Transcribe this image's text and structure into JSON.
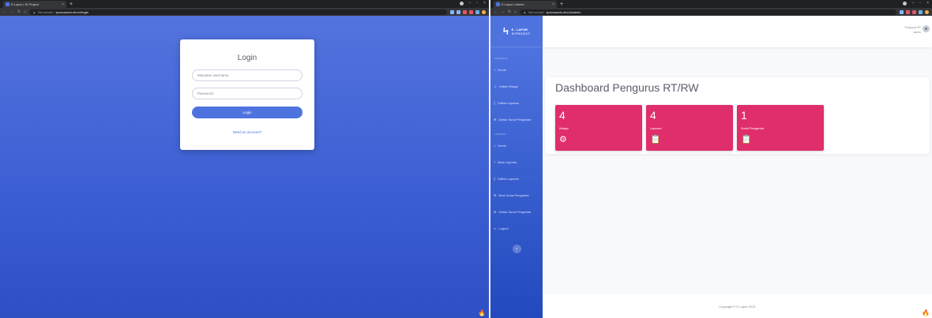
{
  "left": {
    "tab_title": "E-Lapor | SI Project",
    "address": {
      "security": "Not secure",
      "url": "sprocssedo.dev.id/login"
    },
    "login": {
      "title": "Login",
      "username_placeholder": "Masukan username",
      "password_placeholder": "Password",
      "button_label": "Login",
      "need_account_link": "Need an account?"
    }
  },
  "right": {
    "tab_title": "E-Lapor | Admin",
    "address": {
      "security": "Not secure",
      "url": "sprocssedo.dev.id/admin"
    },
    "brand": {
      "line1": "E - LAPOR",
      "line2": "SI PROJECT"
    },
    "sidebar": {
      "headings": [
        "PENGURUS",
        "LAPORAN"
      ],
      "items": [
        {
          "icon": "home-icon",
          "label": "Home"
        },
        {
          "icon": "users-icon",
          "label": "Daftar Warga"
        },
        {
          "icon": "file-icon",
          "label": "Daftar Laporan"
        },
        {
          "icon": "mail-icon",
          "label": "Daftar Surat Pengantar"
        },
        {
          "icon": "home-icon",
          "label": "Home"
        },
        {
          "icon": "plus-icon",
          "label": "Buat Laporan"
        },
        {
          "icon": "file-icon",
          "label": "Daftar Laporan"
        },
        {
          "icon": "mail-icon",
          "label": "Buat Surat Pengantar"
        },
        {
          "icon": "mail-icon",
          "label": "Daftar Surat Pengantar"
        },
        {
          "icon": "logout-icon",
          "label": "Logout"
        }
      ],
      "toggle_glyph": "‹"
    },
    "topbar": {
      "user_line1": "Pengurus RT",
      "user_line2": "admin"
    },
    "dashboard": {
      "title": "Dashboard Pengurus RT/RW",
      "cards": [
        {
          "value": "4",
          "label": "Warga",
          "icon": "users-cog-icon"
        },
        {
          "value": "4",
          "label": "Laporan",
          "icon": "clipboard-icon"
        },
        {
          "value": "1",
          "label": "Surat Pengantar",
          "icon": "clipboard-icon"
        }
      ],
      "card_color": "#e02d6c"
    },
    "footer": "Copyright © E-Lapor 2021"
  },
  "colors": {
    "primary": "#4e73df",
    "primary_dark": "#224abe",
    "accent": "#e02d6c"
  }
}
